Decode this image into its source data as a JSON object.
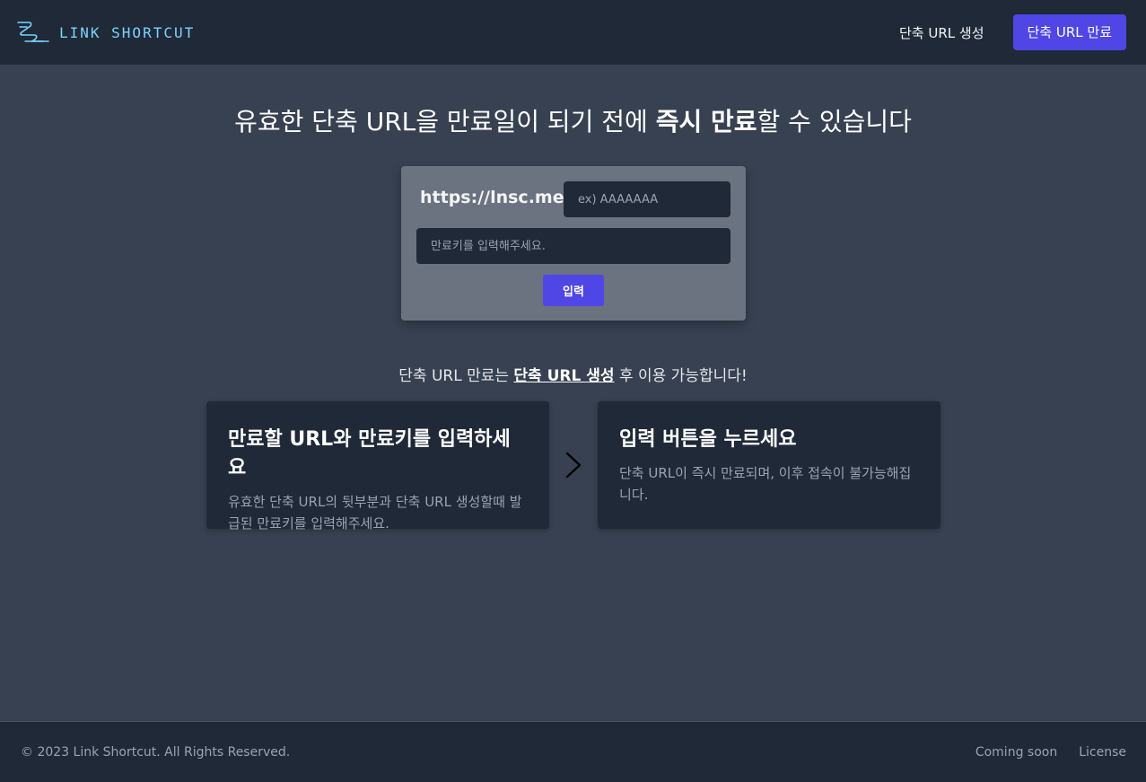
{
  "header": {
    "logo_text": "LINK SHORTCUT",
    "logo_icon": "link-shortcut-logo",
    "nav": {
      "create_label": "단축 URL 생성",
      "expire_label": "단축 URL 만료"
    }
  },
  "hero": {
    "title_part1": "유효한 단축 URL을 만료일이 되기 전에 ",
    "title_bold": "즉시 만료",
    "title_part2": "할 수 있습니다"
  },
  "form": {
    "prefix": "https://lnsc.me/",
    "code_placeholder": "ex) AAAAAAA",
    "key_placeholder": "만료키를 입력해주세요.",
    "submit_label": "입력"
  },
  "notice": {
    "part1": "단축 URL 만료는 ",
    "link": "단축 URL 생성",
    "part2": " 후 이용 가능합니다!"
  },
  "steps": [
    {
      "title": "만료할 URL와 만료키를 입력하세요",
      "description": "유효한 단축 URL의 뒷부분과 단축 URL 생성할때 발급된 만료키를 입력해주세요."
    },
    {
      "title": "입력 버튼을 누르세요",
      "description": "단축 URL이 즉시 만료되며, 이후 접속이 불가능해집니다."
    }
  ],
  "step_arrow_icon": "chevron-right-icon",
  "footer": {
    "copyright": "© 2023 Link Shortcut. All Rights Reserved.",
    "links": [
      "Coming soon",
      "License"
    ]
  },
  "colors": {
    "accent": "#4f46e5",
    "background": "#374151",
    "surface": "#1f2937",
    "form_card": "#6b7280",
    "logo": "#7dd3fc"
  }
}
